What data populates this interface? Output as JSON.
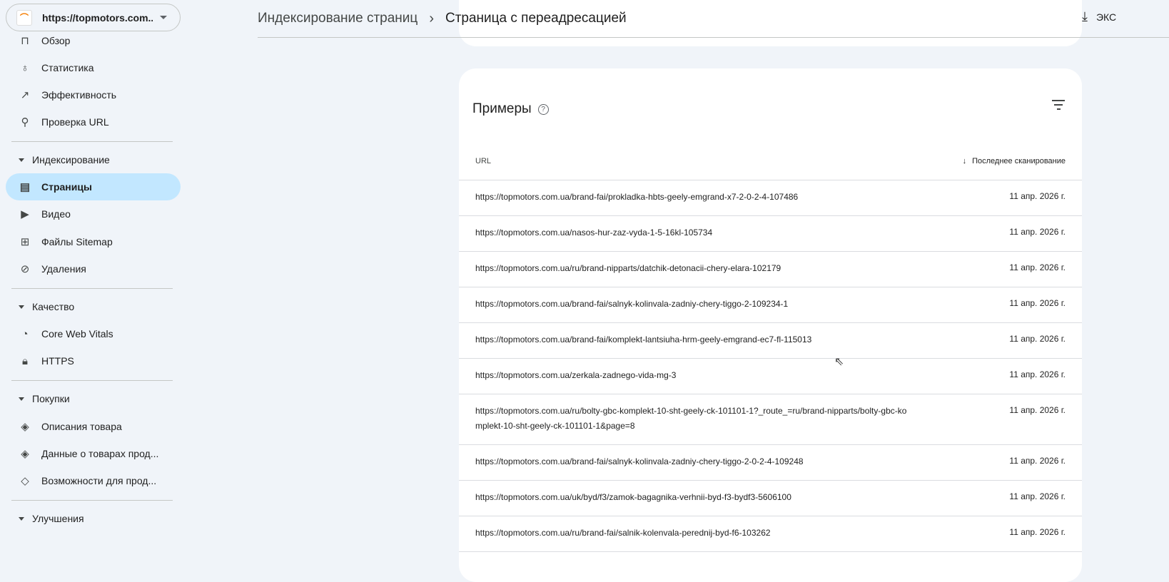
{
  "property": {
    "label": "https://topmotors.com....",
    "logo_icon": "site-favicon"
  },
  "sidebar": {
    "items": [
      {
        "label": "Обзор",
        "icon": "overview-icon"
      },
      {
        "label": "Статистика",
        "icon": "lightbulb-icon"
      },
      {
        "label": "Эффективность",
        "icon": "trending-up-icon"
      },
      {
        "label": "Проверка URL",
        "icon": "search-icon"
      }
    ],
    "sections": [
      {
        "label": "Индексирование",
        "items": [
          {
            "label": "Страницы",
            "active": true
          },
          {
            "label": "Видео"
          },
          {
            "label": "Файлы Sitemap"
          },
          {
            "label": "Удаления"
          }
        ]
      },
      {
        "label": "Качество",
        "items": [
          {
            "label": "Core Web Vitals"
          },
          {
            "label": "HTTPS"
          }
        ]
      },
      {
        "label": "Покупки",
        "items": [
          {
            "label": "Описания товара"
          },
          {
            "label": "Данные о товарах прод..."
          },
          {
            "label": "Возможности для прод..."
          }
        ]
      },
      {
        "label": "Улучшения",
        "items": []
      }
    ]
  },
  "header": {
    "crumb": "Индексирование страниц",
    "current": "Страница с переадресацией",
    "export_label": "ЭКС"
  },
  "card": {
    "title": "Примеры",
    "col_url": "URL",
    "col_date": "Последнее сканирование",
    "rows": [
      {
        "url": "https://topmotors.com.ua/brand-fai/prokladka-hbts-geely-emgrand-x7-2-0-2-4-107486",
        "date": "11 апр. 2026 г."
      },
      {
        "url": "https://topmotors.com.ua/nasos-hur-zaz-vyda-1-5-16kl-105734",
        "date": "11 апр. 2026 г."
      },
      {
        "url": "https://topmotors.com.ua/ru/brand-nipparts/datchik-detonacii-chery-elara-102179",
        "date": "11 апр. 2026 г."
      },
      {
        "url": "https://topmotors.com.ua/brand-fai/salnyk-kolinvala-zadniy-chery-tiggo-2-109234-1",
        "date": "11 апр. 2026 г."
      },
      {
        "url": "https://topmotors.com.ua/brand-fai/komplekt-lantsiuha-hrm-geely-emgrand-ec7-fl-115013",
        "date": "11 апр. 2026 г."
      },
      {
        "url": "https://topmotors.com.ua/zerkala-zadnego-vida-mg-3",
        "date": "11 апр. 2026 г."
      },
      {
        "url": "https://topmotors.com.ua/ru/bolty-gbc-komplekt-10-sht-geely-ck-101101-1?_route_=ru/brand-nipparts/bolty-gbc-komplekt-10-sht-geely-ck-101101-1&page=8",
        "date": "11 апр. 2026 г."
      },
      {
        "url": "https://topmotors.com.ua/brand-fai/salnyk-kolinvala-zadniy-chery-tiggo-2-0-2-4-109248",
        "date": "11 апр. 2026 г."
      },
      {
        "url": "https://topmotors.com.ua/uk/byd/f3/zamok-bagagnika-verhnii-byd-f3-bydf3-5606100",
        "date": "11 апр. 2026 г."
      },
      {
        "url": "https://topmotors.com.ua/ru/brand-fai/salnik-kolenvala-perednij-byd-f6-103262",
        "date": "11 апр. 2026 г."
      }
    ]
  }
}
